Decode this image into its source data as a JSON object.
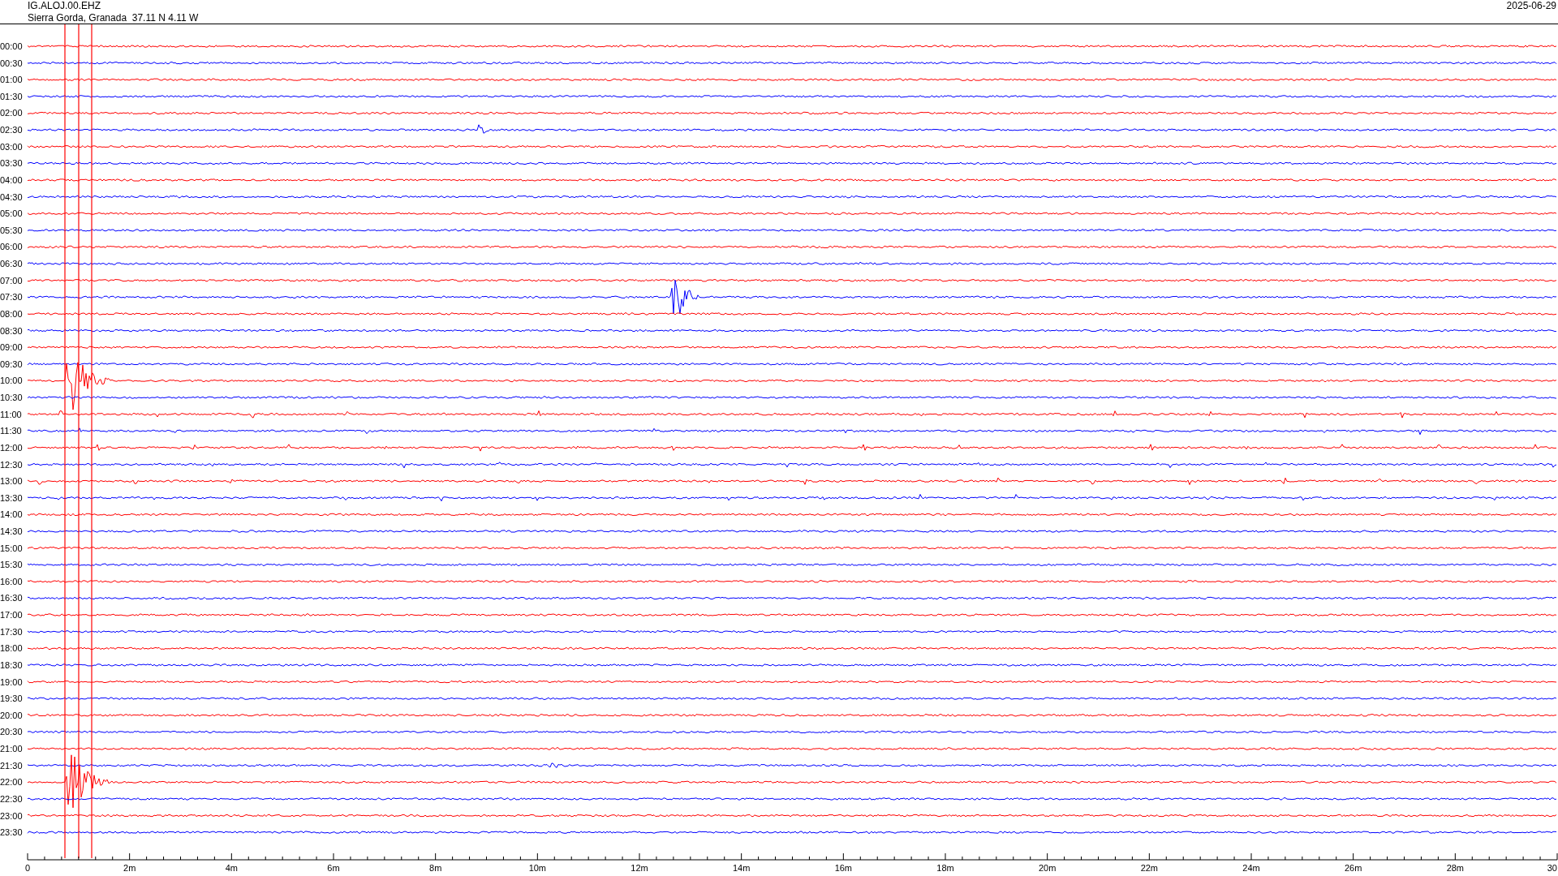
{
  "header": {
    "channel": "IG.ALOJ.00.EHZ",
    "location": "Sierra Gorda, Granada  37.11 N 4.11 W",
    "date": "2025-06-29"
  },
  "rows": [
    {
      "label": "00:00",
      "color": "#ff0000"
    },
    {
      "label": "00:30",
      "color": "#0000ff"
    },
    {
      "label": "01:00",
      "color": "#ff0000"
    },
    {
      "label": "01:30",
      "color": "#0000ff"
    },
    {
      "label": "02:00",
      "color": "#ff0000"
    },
    {
      "label": "02:30",
      "color": "#0000ff"
    },
    {
      "label": "03:00",
      "color": "#ff0000"
    },
    {
      "label": "03:30",
      "color": "#0000ff"
    },
    {
      "label": "04:00",
      "color": "#ff0000"
    },
    {
      "label": "04:30",
      "color": "#0000ff"
    },
    {
      "label": "05:00",
      "color": "#ff0000"
    },
    {
      "label": "05:30",
      "color": "#0000ff"
    },
    {
      "label": "06:00",
      "color": "#ff0000"
    },
    {
      "label": "06:30",
      "color": "#0000ff"
    },
    {
      "label": "07:00",
      "color": "#ff0000"
    },
    {
      "label": "07:30",
      "color": "#0000ff"
    },
    {
      "label": "08:00",
      "color": "#ff0000"
    },
    {
      "label": "08:30",
      "color": "#0000ff"
    },
    {
      "label": "09:00",
      "color": "#ff0000"
    },
    {
      "label": "09:30",
      "color": "#0000ff"
    },
    {
      "label": "10:00",
      "color": "#ff0000"
    },
    {
      "label": "10:30",
      "color": "#0000ff"
    },
    {
      "label": "11:00",
      "color": "#ff0000"
    },
    {
      "label": "11:30",
      "color": "#0000ff"
    },
    {
      "label": "12:00",
      "color": "#ff0000"
    },
    {
      "label": "12:30",
      "color": "#0000ff"
    },
    {
      "label": "13:00",
      "color": "#ff0000"
    },
    {
      "label": "13:30",
      "color": "#0000ff"
    },
    {
      "label": "14:00",
      "color": "#ff0000"
    },
    {
      "label": "14:30",
      "color": "#0000ff"
    },
    {
      "label": "15:00",
      "color": "#ff0000"
    },
    {
      "label": "15:30",
      "color": "#0000ff"
    },
    {
      "label": "16:00",
      "color": "#ff0000"
    },
    {
      "label": "16:30",
      "color": "#0000ff"
    },
    {
      "label": "17:00",
      "color": "#ff0000"
    },
    {
      "label": "17:30",
      "color": "#0000ff"
    },
    {
      "label": "18:00",
      "color": "#ff0000"
    },
    {
      "label": "18:30",
      "color": "#0000ff"
    },
    {
      "label": "19:00",
      "color": "#ff0000"
    },
    {
      "label": "19:30",
      "color": "#0000ff"
    },
    {
      "label": "20:00",
      "color": "#ff0000"
    },
    {
      "label": "20:30",
      "color": "#0000ff"
    },
    {
      "label": "21:00",
      "color": "#ff0000"
    },
    {
      "label": "21:30",
      "color": "#0000ff"
    },
    {
      "label": "22:00",
      "color": "#ff0000"
    },
    {
      "label": "22:30",
      "color": "#0000ff"
    },
    {
      "label": "23:00",
      "color": "#ff0000"
    },
    {
      "label": "23:30",
      "color": "#0000ff"
    }
  ],
  "x_axis": {
    "ticks": [
      "0",
      "2m",
      "4m",
      "6m",
      "8m",
      "10m",
      "12m",
      "14m",
      "16m",
      "18m",
      "20m",
      "22m",
      "24m",
      "26m",
      "28m",
      "30"
    ]
  }
}
